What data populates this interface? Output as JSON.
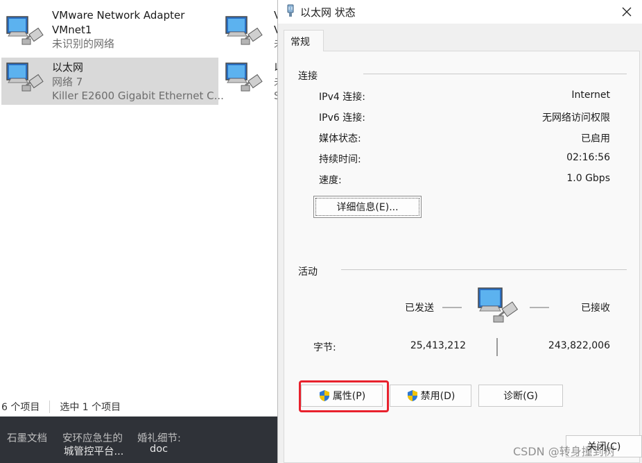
{
  "explorer": {
    "adapters": [
      {
        "name": "VMware Network Adapter",
        "name2": "VMnet1",
        "status": "未识别的网络",
        "icon": "network-adapter-icon"
      },
      {
        "name": "以太网",
        "status": "网络 7",
        "device": "Killer E2600 Gigabit Ethernet C...",
        "icon": "network-adapter-icon"
      },
      {
        "name": "V",
        "name2": "V",
        "status": "未",
        "icon": "network-adapter-icon"
      },
      {
        "name": "以",
        "status": "未",
        "device": "S",
        "icon": "network-adapter-icon"
      }
    ],
    "statusbar": {
      "count": "6 个项目",
      "selected": "选中 1 个项目"
    }
  },
  "taskstrip": {
    "items": [
      "石墨文档",
      "安环应急生的",
      "城管控平台...",
      "婚礼细节:",
      "doc"
    ]
  },
  "dialog": {
    "title": "以太网 状态",
    "tab": "常规",
    "connection": {
      "label": "连接",
      "rows": [
        {
          "label": "IPv4 连接:",
          "value": "Internet"
        },
        {
          "label": "IPv6 连接:",
          "value": "无网络访问权限"
        },
        {
          "label": "媒体状态:",
          "value": "已启用"
        },
        {
          "label": "持续时间:",
          "value": "02:16:56"
        },
        {
          "label": "速度:",
          "value": "1.0 Gbps"
        }
      ],
      "details_button": "详细信息(E)..."
    },
    "activity": {
      "label": "活动",
      "sent_label": "已发送",
      "received_label": "已接收",
      "bytes_label": "字节:",
      "bytes_sent": "25,413,212",
      "bytes_received": "243,822,006"
    },
    "buttons": {
      "properties": "属性(P)",
      "disable": "禁用(D)",
      "diagnose": "诊断(G)",
      "close": "关闭(C)"
    },
    "highlight_color": "#e8212d"
  },
  "watermark": "CSDN @转身撞到树"
}
